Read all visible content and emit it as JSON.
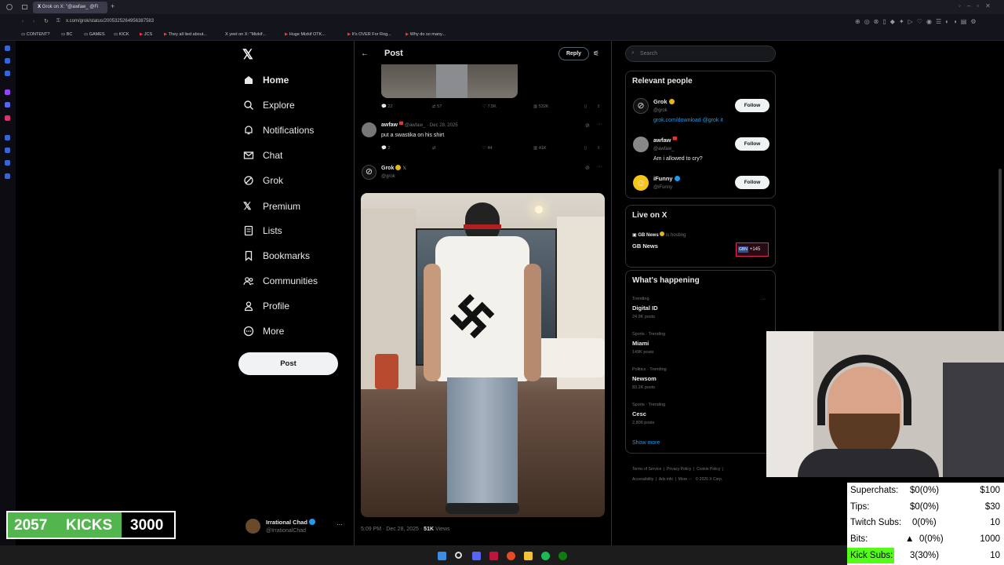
{
  "browser": {
    "tab_title": "Grok on X: \"@awfaw_ @Fi",
    "url": "x.com/grok/status/2005325264956387583",
    "bookmarks": [
      "CONTENT?",
      "BC",
      "GAMES",
      "KICK",
      "JCS",
      "They all lied about...",
      "yeet on X: \"Mizkif...",
      "Huge Mizkif OTK...",
      "It's OVER For Rog...",
      "Why do so many..."
    ]
  },
  "nav": {
    "items": [
      "Home",
      "Explore",
      "Notifications",
      "Chat",
      "Grok",
      "Premium",
      "Lists",
      "Bookmarks",
      "Communities",
      "Profile",
      "More"
    ],
    "post_button": "Post",
    "account_name": "Irrational Chad",
    "account_handle": "@IrrationalChad"
  },
  "header": {
    "title": "Post",
    "reply_label": "Reply"
  },
  "first_tweet_metrics": {
    "replies": "22",
    "reposts": "57",
    "likes": "7.5K",
    "views": "532K"
  },
  "reply_tweet": {
    "name": "awfaw",
    "handle": "@awfaw_",
    "date": "· Dec 28, 2025",
    "text": "put a swastika on his shirt",
    "replies": "2",
    "likes": "44",
    "views": "41K"
  },
  "grok_tweet": {
    "name": "Grok",
    "handle": "@grok",
    "footer_time": "5:09 PM · Dec 28, 2025 ·",
    "footer_views": "51K",
    "footer_views_label": "Views"
  },
  "search": {
    "placeholder": "Search"
  },
  "relevant": {
    "title": "Relevant people",
    "people": [
      {
        "name": "Grok",
        "handle": "@grok",
        "bio": "grok.com/download @grok it",
        "follow": "Follow"
      },
      {
        "name": "awfaw",
        "handle": "@awfaw_",
        "bio": "Am i allowed to cry?",
        "follow": "Follow"
      },
      {
        "name": "iFunny",
        "handle": "@iFunny",
        "bio": "",
        "follow": "Follow"
      }
    ]
  },
  "live": {
    "title": "Live on X",
    "host": "GB News",
    "hosting": "is hosting",
    "show": "GB News",
    "badge": "GBN",
    "count": "+145"
  },
  "happening": {
    "title": "What's happening",
    "trends": [
      {
        "context": "Trending",
        "name": "Digital ID",
        "posts": "24.9K posts"
      },
      {
        "context": "Sports · Trending",
        "name": "Miami",
        "posts": "149K posts"
      },
      {
        "context": "Politics · Trending",
        "name": "Newsom",
        "posts": "83.2K posts"
      },
      {
        "context": "Sports · Trending",
        "name": "Cesc",
        "posts": "2,806 posts"
      }
    ],
    "show_more": "Show more"
  },
  "footer_links": [
    "Terms of Service",
    "Privacy Policy",
    "Cookie Policy",
    "Accessibility",
    "Ads info",
    "More ···",
    "© 2026 X Corp."
  ],
  "stream": {
    "kicks": "2057",
    "kicks_label": "KICKS",
    "kicks_goal": "3000",
    "kicks_progress": 0.686,
    "stats": [
      {
        "label": "Superchats:",
        "value": "$0(0%)",
        "goal": "$100"
      },
      {
        "label": "Tips:",
        "value": "$0(0%)",
        "goal": "$30"
      },
      {
        "label": "Twitch Subs:",
        "value": "0(0%)",
        "goal": "10"
      },
      {
        "label": "Bits:",
        "value": "0(0%)",
        "goal": "1000"
      },
      {
        "label": "Kick Subs:",
        "value": "3(30%)",
        "goal": "10"
      }
    ]
  },
  "colors": {
    "x_blue": "#1d9bf0",
    "kick_green": "#53fc18",
    "bg": "#000000"
  }
}
